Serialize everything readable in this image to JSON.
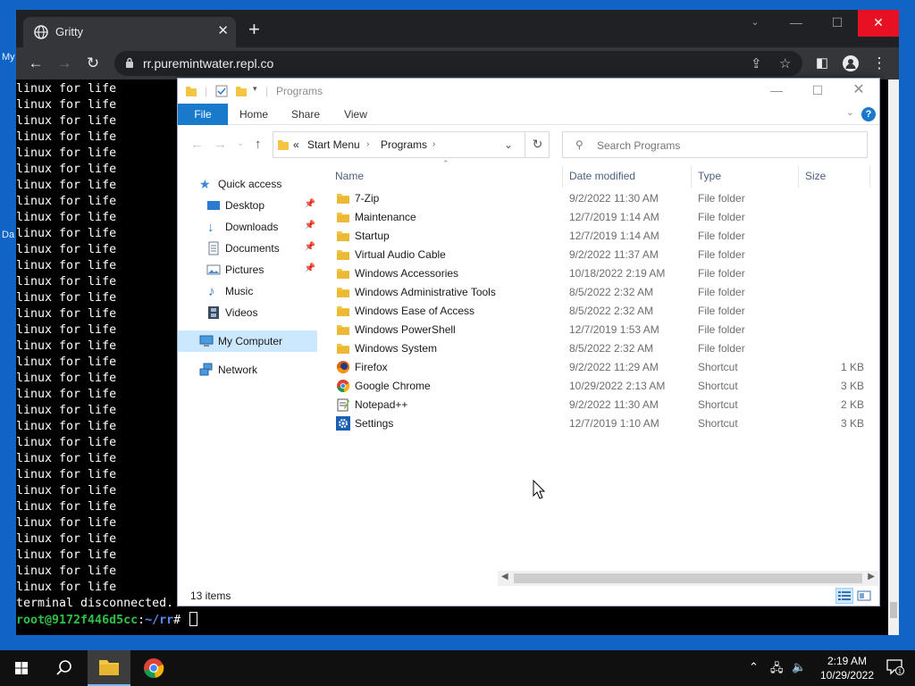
{
  "desktop": {
    "icon_label_1": "My",
    "icon_label_2": "Da"
  },
  "browser": {
    "tab_title": "Gritty",
    "url": "rr.puremintwater.repl.co"
  },
  "terminal": {
    "repeat_line": "linux for life",
    "repeat_count": 32,
    "disconnected": "terminal disconnected.",
    "prompt_user": "root@9172f446d5cc",
    "prompt_sep": ":",
    "prompt_path": "~/rr",
    "prompt_end": "#"
  },
  "explorer": {
    "title": "Programs",
    "ribbon": {
      "file": "File",
      "home": "Home",
      "share": "Share",
      "view": "View"
    },
    "breadcrumb": {
      "prefix": "«",
      "start_menu": "Start Menu",
      "programs": "Programs"
    },
    "search_placeholder": "Search Programs",
    "nav": {
      "quick_access": "Quick access",
      "desktop": "Desktop",
      "downloads": "Downloads",
      "documents": "Documents",
      "pictures": "Pictures",
      "music": "Music",
      "videos": "Videos",
      "my_computer": "My Computer",
      "network": "Network"
    },
    "columns": {
      "name": "Name",
      "date": "Date modified",
      "type": "Type",
      "size": "Size"
    },
    "files": [
      {
        "name": "7-Zip",
        "date": "9/2/2022 11:30 AM",
        "type": "File folder",
        "size": "",
        "icon": "folder-icon"
      },
      {
        "name": "Maintenance",
        "date": "12/7/2019 1:14 AM",
        "type": "File folder",
        "size": "",
        "icon": "folder-icon"
      },
      {
        "name": "Startup",
        "date": "12/7/2019 1:14 AM",
        "type": "File folder",
        "size": "",
        "icon": "folder-icon"
      },
      {
        "name": "Virtual Audio Cable",
        "date": "9/2/2022 11:37 AM",
        "type": "File folder",
        "size": "",
        "icon": "folder-icon"
      },
      {
        "name": "Windows Accessories",
        "date": "10/18/2022 2:19 AM",
        "type": "File folder",
        "size": "",
        "icon": "folder-icon"
      },
      {
        "name": "Windows Administrative Tools",
        "date": "8/5/2022 2:32 AM",
        "type": "File folder",
        "size": "",
        "icon": "folder-icon"
      },
      {
        "name": "Windows Ease of Access",
        "date": "8/5/2022 2:32 AM",
        "type": "File folder",
        "size": "",
        "icon": "folder-icon"
      },
      {
        "name": "Windows PowerShell",
        "date": "12/7/2019 1:53 AM",
        "type": "File folder",
        "size": "",
        "icon": "folder-icon"
      },
      {
        "name": "Windows System",
        "date": "8/5/2022 2:32 AM",
        "type": "File folder",
        "size": "",
        "icon": "folder-icon"
      },
      {
        "name": "Firefox",
        "date": "9/2/2022 11:29 AM",
        "type": "Shortcut",
        "size": "1 KB",
        "icon": "firefox-icon"
      },
      {
        "name": "Google Chrome",
        "date": "10/29/2022 2:13 AM",
        "type": "Shortcut",
        "size": "3 KB",
        "icon": "chrome-icon"
      },
      {
        "name": "Notepad++",
        "date": "9/2/2022 11:30 AM",
        "type": "Shortcut",
        "size": "2 KB",
        "icon": "notepad-icon"
      },
      {
        "name": "Settings",
        "date": "12/7/2019 1:10 AM",
        "type": "Shortcut",
        "size": "3 KB",
        "icon": "settings-icon"
      }
    ],
    "item_count": "13 items"
  },
  "taskbar": {
    "time": "2:19 AM",
    "date": "10/29/2022",
    "notifications": "1"
  },
  "colors": {
    "desktop": "#0f64c6",
    "ribbon_file": "#1979ca",
    "folder": "#f4c542",
    "prompt_user": "#2ec14a",
    "prompt_path": "#5b8cf0"
  }
}
